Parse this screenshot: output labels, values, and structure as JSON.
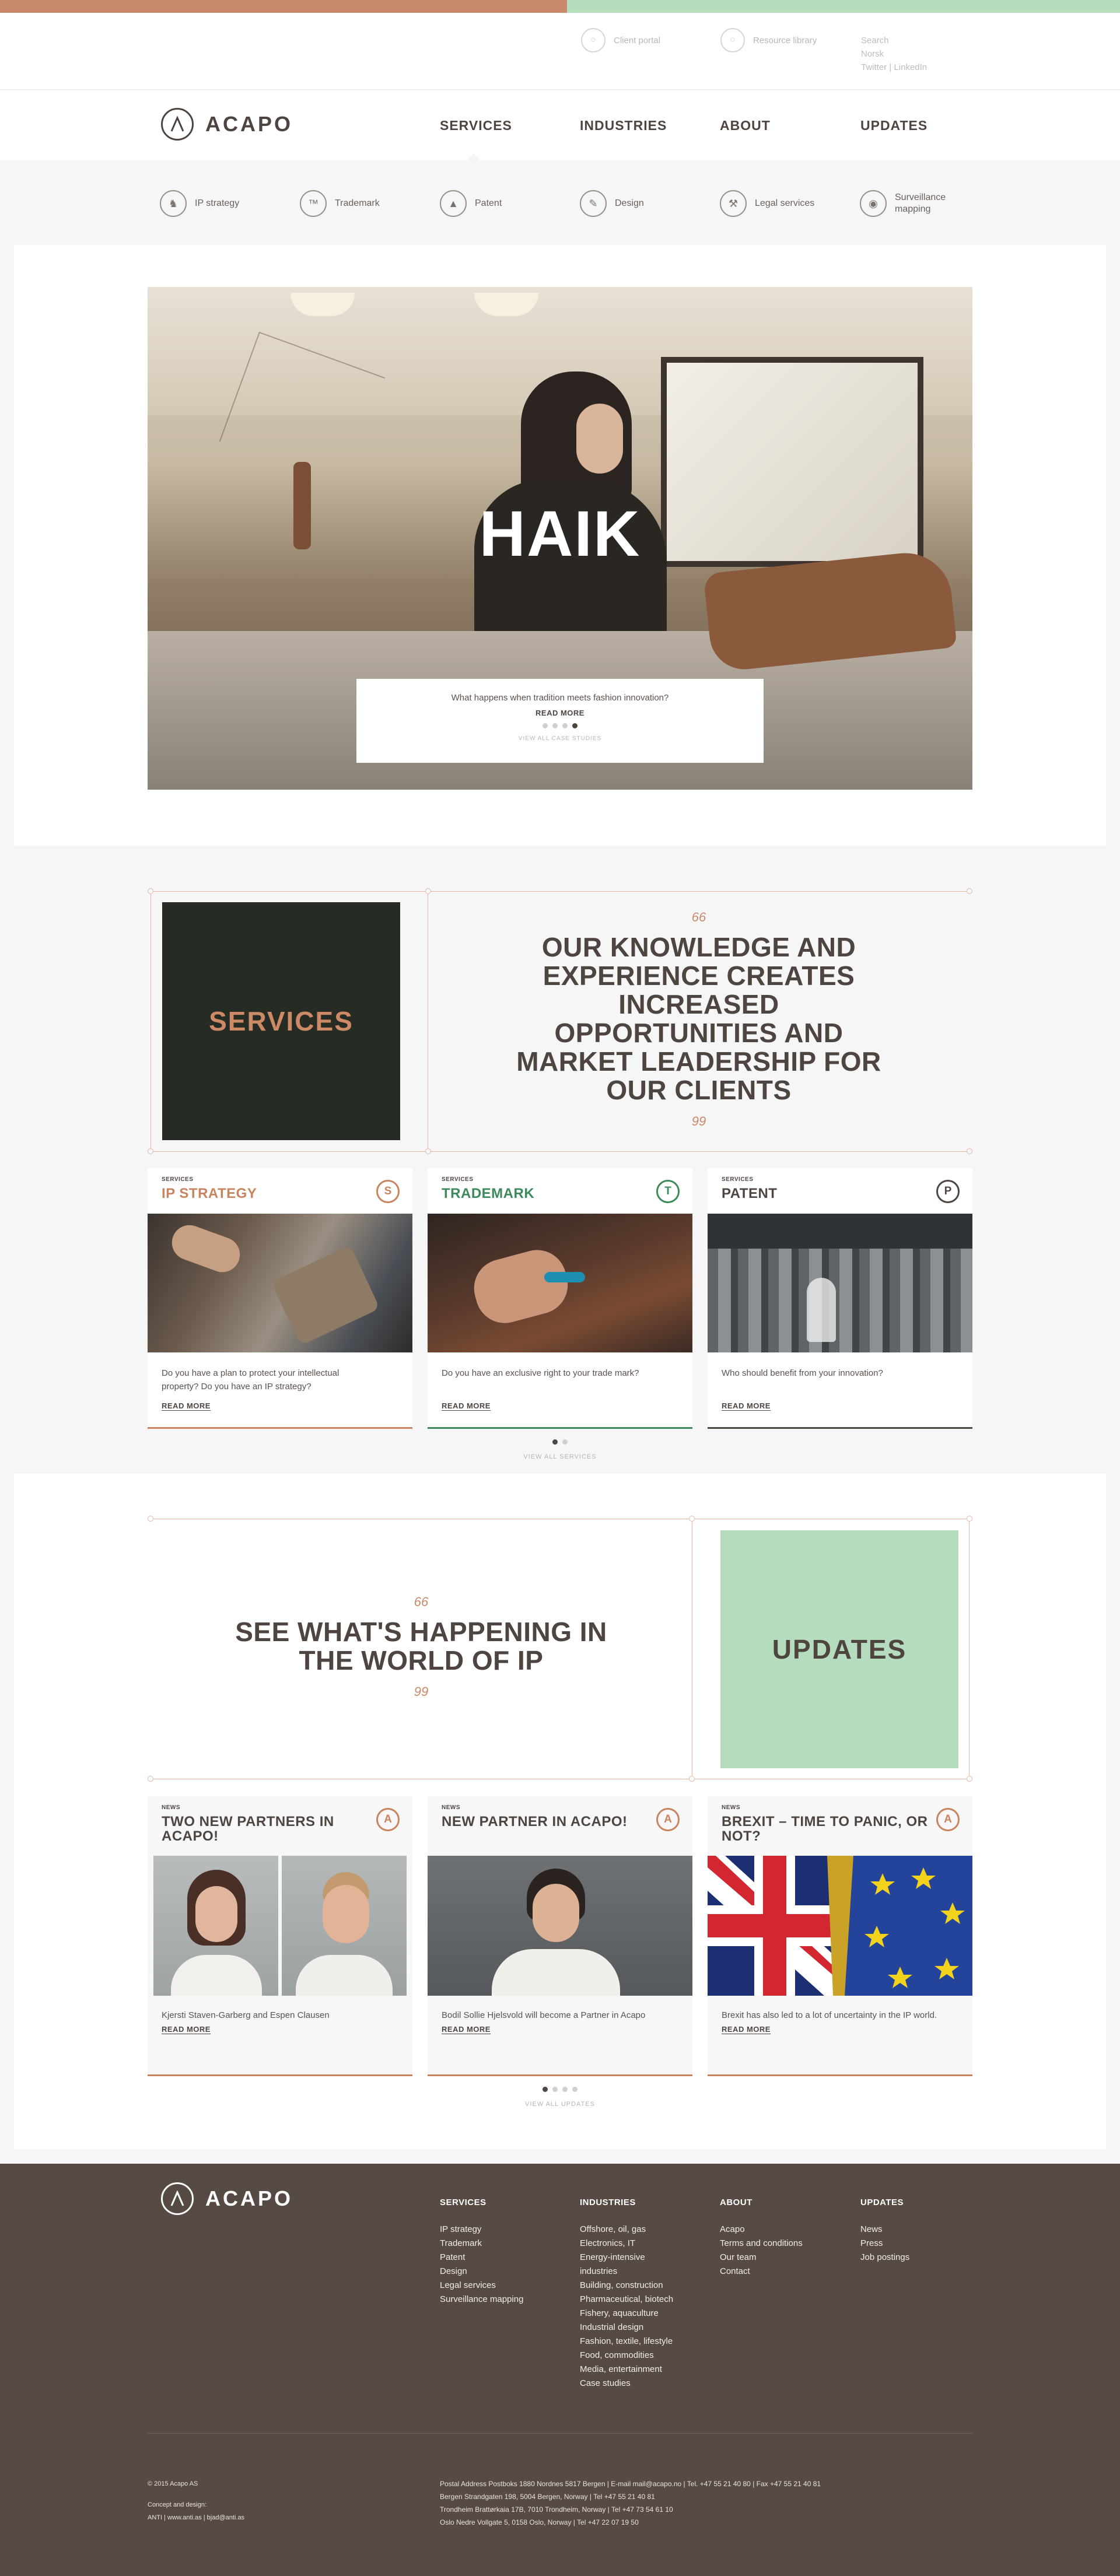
{
  "utility": {
    "client_portal": "Client portal",
    "resource_library": "Resource library",
    "search": "Search",
    "language": "Norsk",
    "twitter": "Twitter",
    "separator": "|",
    "linkedin": "LinkedIn"
  },
  "brand": {
    "name": "ACAPO",
    "logo_icon": "acapo-a-icon"
  },
  "nav": {
    "services": "SERVICES",
    "industries": "INDUSTRIES",
    "about": "ABOUT",
    "updates": "UPDATES"
  },
  "subnav": [
    {
      "label": "IP strategy",
      "icon": "chess-icon"
    },
    {
      "label": "Trademark",
      "icon": "tm-icon"
    },
    {
      "label": "Patent",
      "icon": "flask-icon"
    },
    {
      "label": "Design",
      "icon": "pen-icon"
    },
    {
      "label": "Legal services",
      "icon": "gavel-icon"
    },
    {
      "label": "Surveillance",
      "label2": "mapping",
      "icon": "eye-icon"
    }
  ],
  "hero": {
    "title": "HAIK",
    "question": "What happens when tradition meets fashion innovation?",
    "read_more": "READ MORE",
    "view_all": "VIEW ALL CASE STUDIES",
    "dots": [
      false,
      false,
      false,
      true
    ]
  },
  "services_tile": {
    "label": "SERVICES"
  },
  "quote1": {
    "open": "66",
    "line1": "OUR KNOWLEDGE AND",
    "line2": "EXPERIENCE CREATES",
    "line3": "INCREASED",
    "line4": "OPPORTUNITIES AND",
    "line5": "MARKET LEADERSHIP FOR",
    "line6": "OUR CLIENTS",
    "close": "99"
  },
  "service_cards": [
    {
      "kicker": "SERVICES",
      "title": "IP STRATEGY",
      "badge": "S",
      "color": "#c8835f",
      "text1": "Do you have a plan to protect your intellectual",
      "text2": "property? Do you have an IP strategy?",
      "read_more": "READ MORE"
    },
    {
      "kicker": "SERVICES",
      "title": "TRADEMARK",
      "badge": "T",
      "color": "#3c8a5a",
      "text1": "Do you have an exclusive right to your trade mark?",
      "text2": "",
      "read_more": "READ MORE"
    },
    {
      "kicker": "SERVICES",
      "title": "PATENT",
      "badge": "P",
      "color": "#4e4440",
      "text1": "Who should benefit from your innovation?",
      "text2": "",
      "read_more": "READ MORE"
    }
  ],
  "services_view_all": "VIEW ALL SERVICES",
  "quote2": {
    "open": "66",
    "line1": "SEE WHAT'S HAPPENING IN",
    "line2": "THE WORLD OF IP",
    "close": "99"
  },
  "updates_tile": {
    "label": "UPDATES"
  },
  "news_cards": [
    {
      "kicker": "NEWS",
      "title1": "TWO NEW PARTNERS IN",
      "title2": "ACAPO!",
      "badge": "A",
      "text": "Kjersti Staven-Garberg and Espen Clausen",
      "read_more": "READ MORE"
    },
    {
      "kicker": "NEWS",
      "title1": "NEW PARTNER IN ACAPO!",
      "title2": "",
      "badge": "A",
      "text": "Bodil Sollie Hjelsvold will become a Partner in Acapo",
      "read_more": "READ MORE"
    },
    {
      "kicker": "NEWS",
      "title1": "BREXIT – TIME TO PANIC, OR",
      "title2": "NOT?",
      "badge": "A",
      "text": "Brexit has also led to a lot of uncertainty in the IP world.",
      "read_more": "READ MORE"
    }
  ],
  "updates_view_all": "VIEW ALL UPDATES",
  "footer": {
    "cols": [
      {
        "title": "SERVICES",
        "items": [
          "IP strategy",
          "Trademark",
          "Patent",
          "Design",
          "Legal services",
          "Surveillance mapping"
        ]
      },
      {
        "title": "INDUSTRIES",
        "items": [
          "Offshore, oil, gas",
          "Electronics, IT",
          "Energy-intensive",
          "industries",
          "Building, construction",
          "Pharmaceutical, biotech",
          "Fishery, aquaculture",
          "Industrial design",
          "Fashion, textile, lifestyle",
          "Food, commodities",
          "Media, entertainment",
          "Case studies"
        ]
      },
      {
        "title": "ABOUT",
        "items": [
          "Acapo",
          "Terms and conditions",
          "Our team",
          "Contact"
        ]
      },
      {
        "title": "UPDATES",
        "items": [
          "News",
          "Press",
          "Job postings"
        ]
      }
    ],
    "copyright": "© 2015 Acapo AS",
    "concept": "Concept and design:",
    "agency": "ANTI | www.anti.as | bjad@anti.as",
    "addr1": "Postal Address Postboks 1880 Nordnes 5817 Bergen | E-mail mail@acapo.no | Tel. +47 55 21 40 80 | Fax +47 55 21 40 81",
    "addr2": "Bergen Strandgaten 198, 5004 Bergen, Norway | Tel +47 55 21 40 81",
    "addr3": "Trondheim Brattørkaia 17B, 7010 Trondheim, Norway | Tel +47 73 54 61 10",
    "addr4": "Oslo Nedre Vollgate 5, 0158 Oslo, Norway | Tel +47 22 07 19 50"
  },
  "colors": {
    "brand_copper": "#c8896a",
    "brand_mint": "#b4dcbd",
    "text_dark": "#4e4440",
    "footer_bg": "#564a45",
    "services_tile": "#262b24"
  }
}
